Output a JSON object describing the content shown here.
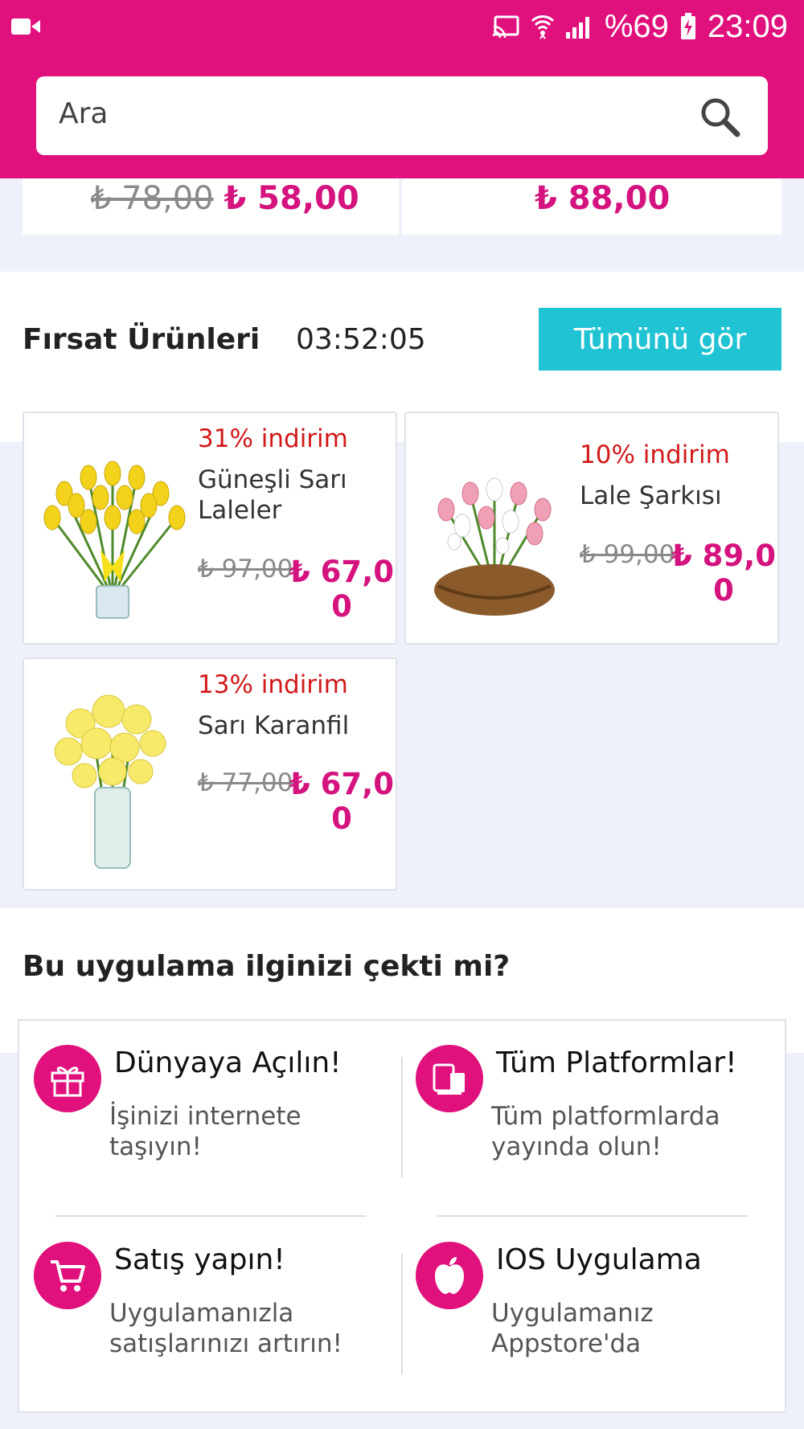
{
  "status_bar": {
    "battery": "%69",
    "time": "23:09"
  },
  "search": {
    "placeholder": "Ara"
  },
  "top_prices": [
    {
      "old": "₺ 78,00",
      "new": "₺ 58,00"
    },
    {
      "new": "₺ 88,00"
    }
  ],
  "deals": {
    "title": "Fırsat Ürünleri",
    "countdown": "03:52:05",
    "see_all": "Tümünü gör",
    "products": [
      {
        "discount": "31% indirim",
        "name": "Güneşli Sarı Laleler",
        "old_price": "₺ 97,00",
        "new_price": "₺ 67,00"
      },
      {
        "discount": "10% indirim",
        "name": "Lale Şarkısı",
        "old_price": "₺ 99,00",
        "new_price": "₺ 89,00"
      },
      {
        "discount": "13% indirim",
        "name": "Sarı Karanfil",
        "old_price": "₺ 77,00",
        "new_price": "₺ 67,00"
      }
    ]
  },
  "promo": {
    "title": "Bu uygulama ilginizi çekti mi?",
    "features": [
      {
        "icon": "gift-icon",
        "title": "Dünyaya Açılın!",
        "desc": "İşinizi internete taşıyın!"
      },
      {
        "icon": "devices-icon",
        "title": "Tüm Platformlar!",
        "desc": "Tüm platformlarda yayında olun!"
      },
      {
        "icon": "cart-icon",
        "title": "Satış yapın!",
        "desc": "Uygulamanızla satışlarınızı artırın!"
      },
      {
        "icon": "apple-icon",
        "title": "IOS Uygulama",
        "desc": "Uygulamanız Appstore'da"
      }
    ]
  },
  "colors": {
    "brand": "#e0107c",
    "price": "#d4137f",
    "discount": "#d11919",
    "button": "#1fc3d3",
    "background": "#eef1fa"
  }
}
